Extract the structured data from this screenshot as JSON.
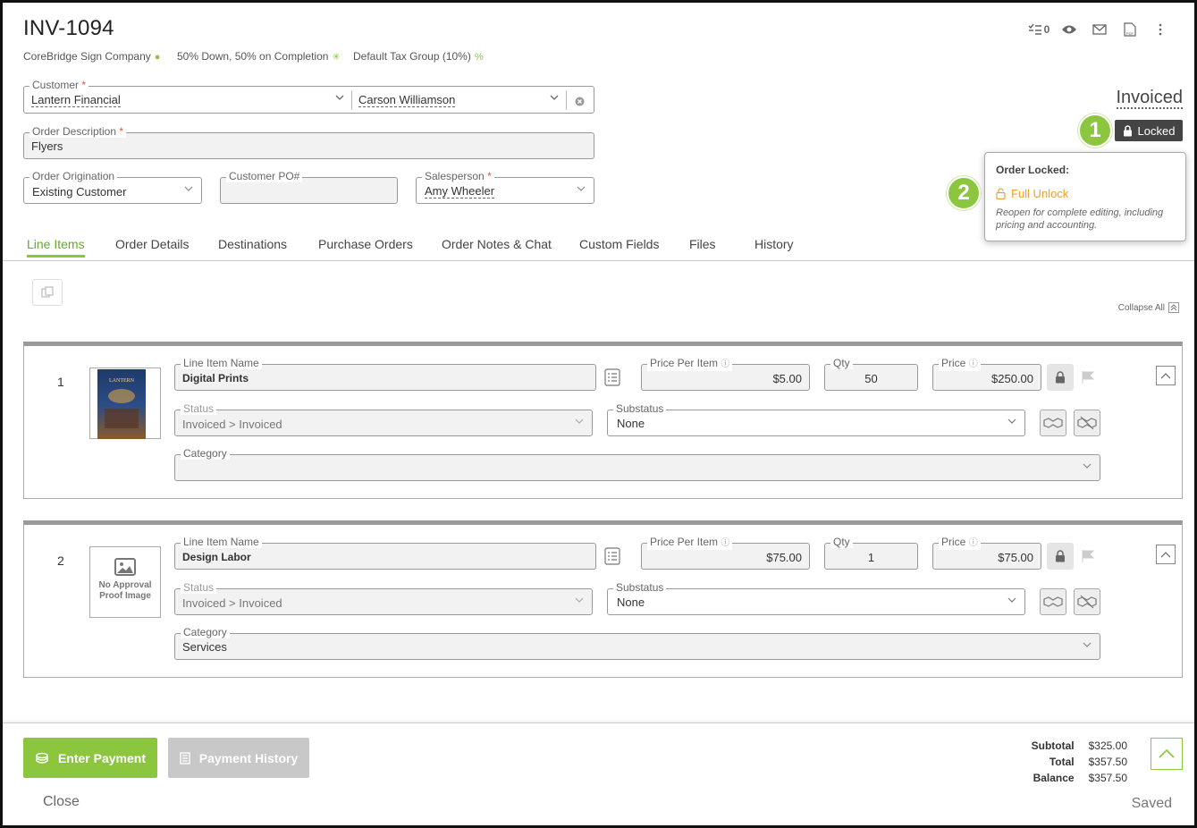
{
  "header": {
    "title": "INV-1094",
    "company": "CoreBridge Sign Company",
    "terms": "50% Down, 50% on Completion",
    "tax_group": "Default Tax Group (10%)",
    "tasks_count": "0"
  },
  "form": {
    "customer_label": "Customer",
    "customer_value": "Lantern Financial",
    "contact_value": "Carson Williamson",
    "description_label": "Order Description",
    "description_value": "Flyers",
    "origination_label": "Order Origination",
    "origination_value": "Existing Customer",
    "po_label": "Customer PO#",
    "po_value": "",
    "salesperson_label": "Salesperson",
    "salesperson_value": "Amy Wheeler",
    "required_mark": "*"
  },
  "status": {
    "label": "Invoiced",
    "locked_button": "Locked"
  },
  "badges": [
    "1",
    "2"
  ],
  "popover": {
    "heading": "Order Locked:",
    "link": "Full Unlock",
    "description": "Reopen for complete editing, including pricing and accounting."
  },
  "tabs": [
    "Line Items",
    "Order Details",
    "Destinations",
    "Purchase Orders",
    "Order Notes & Chat",
    "Custom Fields",
    "Files",
    "History"
  ],
  "collapse_all": "Collapse All",
  "labels": {
    "line_item_name": "Line Item Name",
    "price_per_item": "Price Per Item",
    "qty": "Qty",
    "price": "Price",
    "status": "Status",
    "substatus": "Substatus",
    "category": "Category"
  },
  "line_items": [
    {
      "number": "1",
      "name": "Digital Prints",
      "price_per_item": "$5.00",
      "qty": "50",
      "price": "$250.00",
      "status": "Invoiced > Invoiced",
      "substatus": "None",
      "category": "",
      "thumb_text": "LANTERN"
    },
    {
      "number": "2",
      "name": "Design Labor",
      "price_per_item": "$75.00",
      "qty": "1",
      "price": "$75.00",
      "status": "Invoiced > Invoiced",
      "substatus": "None",
      "category": "Services",
      "thumb_text": "No Approval Proof Image"
    }
  ],
  "footer": {
    "enter_payment": "Enter Payment",
    "payment_history": "Payment History",
    "close": "Close",
    "saved": "Saved",
    "subtotal_label": "Subtotal",
    "subtotal": "$325.00",
    "total_label": "Total",
    "total": "$357.50",
    "balance_label": "Balance",
    "balance": "$357.50"
  },
  "colors": {
    "accent": "#8cc63f",
    "link_orange": "#f0a030",
    "locked_bg": "#444444"
  }
}
